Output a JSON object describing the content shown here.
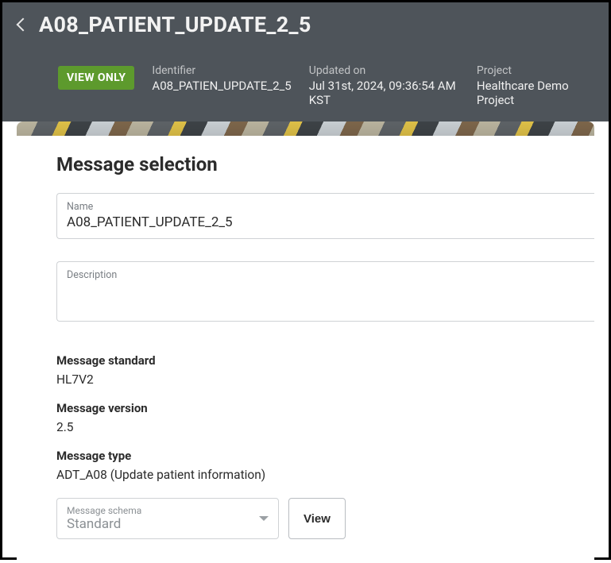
{
  "header": {
    "title": "A08_PATIENT_UPDATE_2_5",
    "badge": "VIEW ONLY",
    "identifier_label": "Identifier",
    "identifier_value": "A08_PATIEN_UPDATE_2_5",
    "updated_label": "Updated on",
    "updated_value": "Jul 31st, 2024, 09:36:54 AM KST",
    "project_label": "Project",
    "project_value": "Healthcare Demo Project"
  },
  "section": {
    "title": "Message selection",
    "name_label": "Name",
    "name_value": "A08_PATIENT_UPDATE_2_5",
    "description_label": "Description",
    "description_value": "",
    "standard_label": "Message standard",
    "standard_value": "HL7V2",
    "version_label": "Message version",
    "version_value": "2.5",
    "type_label": "Message type",
    "type_value": "ADT_A08 (Update patient information)",
    "schema_label": "Message schema",
    "schema_value": "Standard",
    "view_button": "View"
  }
}
